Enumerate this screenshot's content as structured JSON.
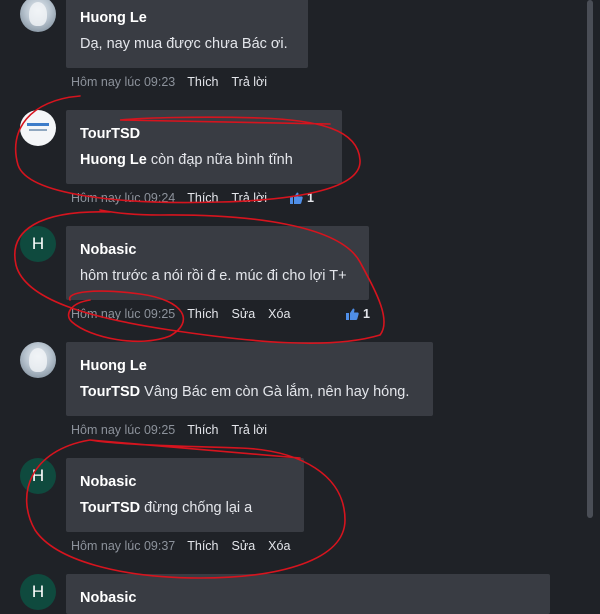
{
  "comments": [
    {
      "author": "Huong Le",
      "mention": "",
      "text": "Dạ, nay mua được chưa Bác ơi.",
      "timestamp": "Hôm nay lúc 09:23",
      "actions": [
        "Thích",
        "Trả lời"
      ],
      "likes": ""
    },
    {
      "author": "TourTSD",
      "mention": "Huong Le",
      "text": " còn đạp nữa bình tĩnh",
      "timestamp": "Hôm nay lúc 09:24",
      "actions": [
        "Thích",
        "Trả lời"
      ],
      "likes": "1"
    },
    {
      "author": "Nobasic",
      "avatar_letter": "H",
      "mention": "",
      "text": "hôm trước a nói rồi đ e. múc đi cho lợi T+",
      "timestamp": "Hôm nay lúc 09:25",
      "actions": [
        "Thích",
        "Sửa",
        "Xóa"
      ],
      "likes": "1"
    },
    {
      "author": "Huong Le",
      "mention": "TourTSD",
      "text": " Vâng Bác em còn Gà lắm, nên hay hóng.",
      "timestamp": "Hôm nay lúc 09:25",
      "actions": [
        "Thích",
        "Trả lời"
      ],
      "likes": ""
    },
    {
      "author": "Nobasic",
      "avatar_letter": "H",
      "mention": "TourTSD",
      "text": " đừng chống lại a",
      "timestamp": "Hôm nay lúc 09:37",
      "actions": [
        "Thích",
        "Sửa",
        "Xóa"
      ],
      "likes": ""
    },
    {
      "author": "Nobasic",
      "avatar_letter": "H"
    }
  ],
  "colors": {
    "background": "#1f2227",
    "bubble": "#393c43",
    "annotation": "#d6141e",
    "like": "#4f8fe8"
  },
  "icons": {
    "like": "thumbs-up-icon"
  }
}
